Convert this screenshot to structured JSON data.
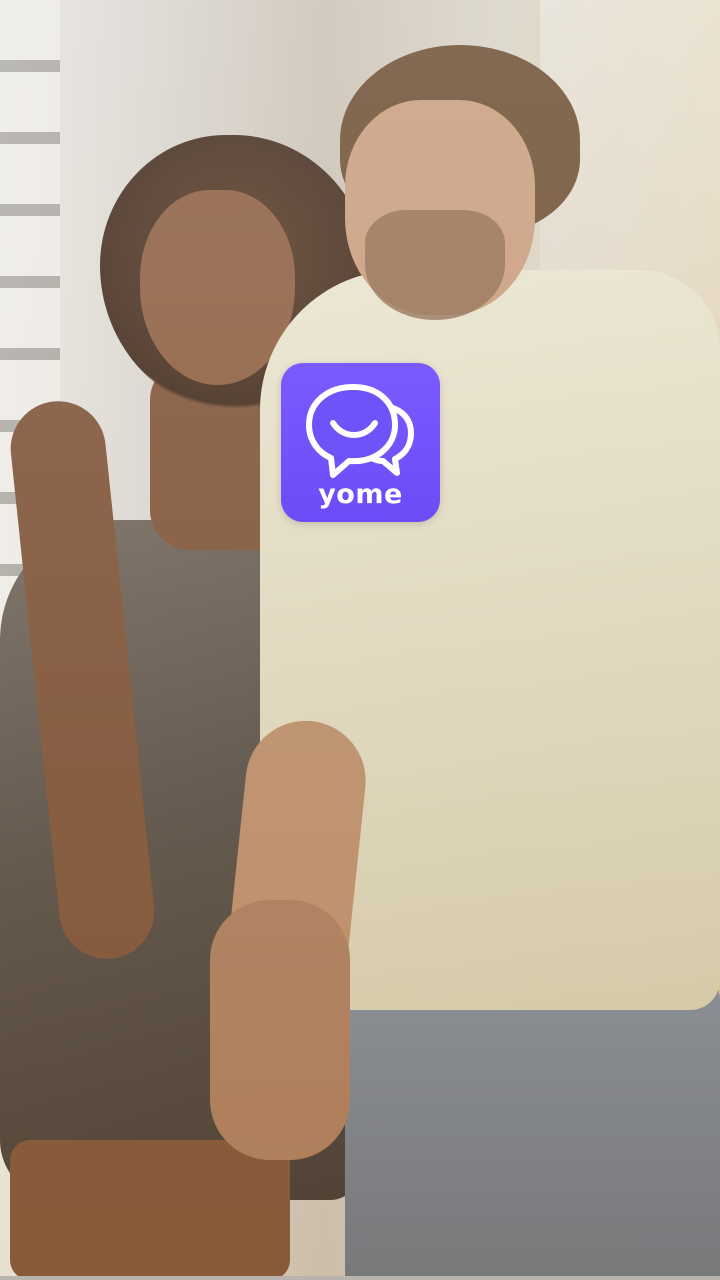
{
  "app": {
    "name": "yome",
    "logo_icon": "chat-bubbles-smile-icon",
    "brand_color": "#7055fa"
  },
  "background": {
    "image": "couple-holding-hands-photo"
  }
}
